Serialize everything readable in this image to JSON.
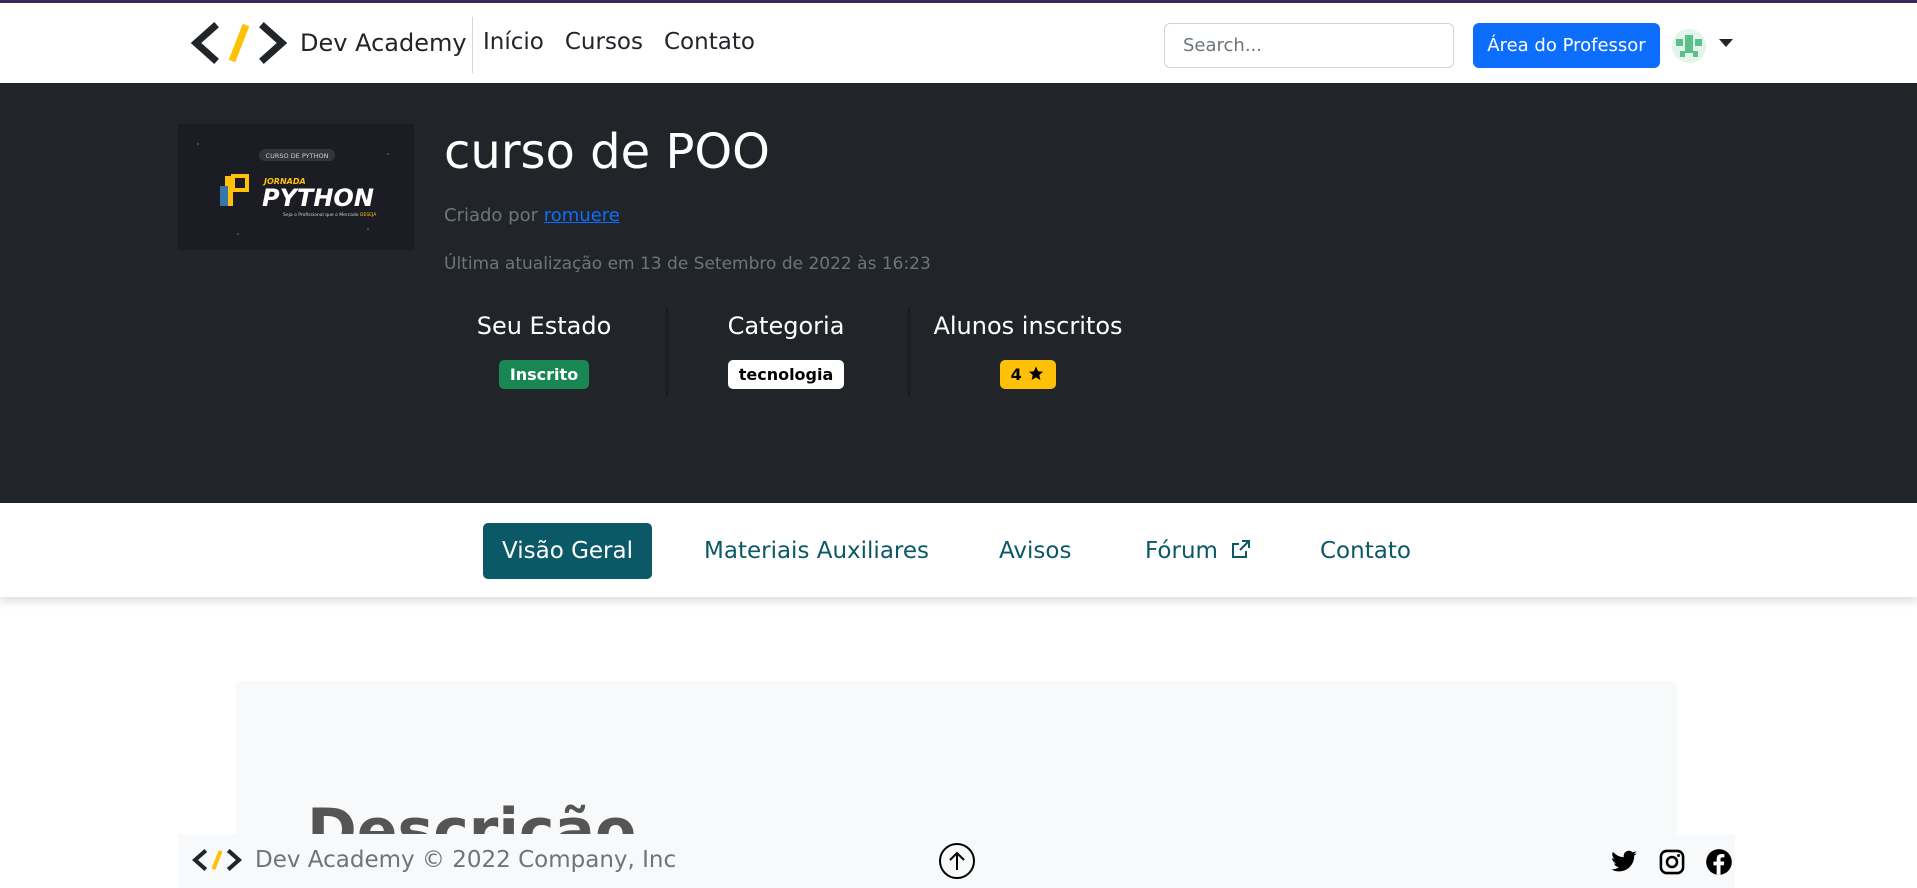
{
  "nav": {
    "brand": "Dev Academy",
    "links": [
      "Início",
      "Cursos",
      "Contato"
    ],
    "search_placeholder": "Search...",
    "teacher_button": "Área do Professor"
  },
  "course": {
    "thumbnail": {
      "pill": "CURSO DE PYTHON",
      "small_title": "JORNADA",
      "big_title": "PYTHON",
      "tagline_prefix": "Seja o Profissional que o Mercado",
      "tagline_highlight": "DESEJA"
    },
    "title": "curso de POO",
    "created_by_label": "Criado por",
    "author": "romuere",
    "updated": "Última atualização em 13 de Setembro de 2022 às 16:23",
    "stats": [
      {
        "label": "Seu Estado",
        "value": "Inscrito"
      },
      {
        "label": "Categoria",
        "value": "tecnologia"
      },
      {
        "label": "Alunos inscritos",
        "value": "4"
      }
    ]
  },
  "tabs": [
    "Visão Geral",
    "Materiais Auxiliares",
    "Avisos",
    "Fórum",
    "Contato"
  ],
  "description_title": "Descrição",
  "footer": {
    "text": "Dev Academy © 2022 Company, Inc"
  },
  "colors": {
    "primary": "#0d6efd",
    "tab_active": "#0b5866",
    "hero_bg": "#212529",
    "badge_success": "#198754",
    "badge_warning": "#ffc107"
  },
  "icons": [
    "code-logo-icon",
    "chevron-down-icon",
    "star-icon",
    "external-link-icon",
    "arrow-up-circle-icon",
    "twitter-icon",
    "instagram-icon",
    "facebook-icon"
  ]
}
